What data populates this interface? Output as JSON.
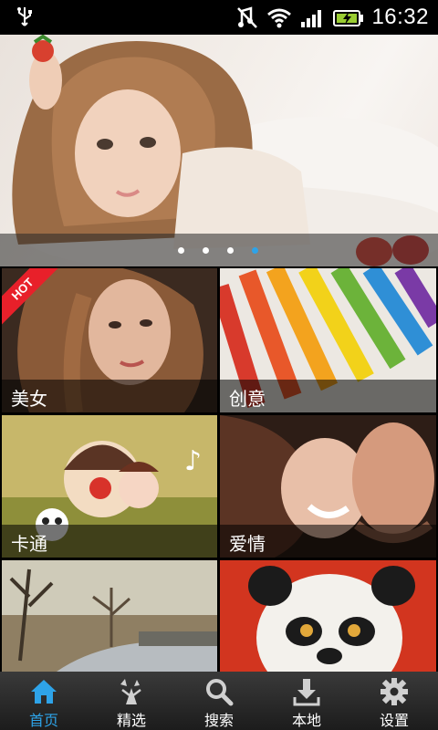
{
  "status_bar": {
    "time": "16:32",
    "icons": [
      "usb-icon",
      "silent-icon",
      "wifi-icon",
      "signal-icon",
      "battery-charging-icon"
    ]
  },
  "banner": {
    "page_count": 4,
    "active_page": 4,
    "description_icon": "banner-photo"
  },
  "categories": [
    {
      "label": "美女",
      "badge": "HOT"
    },
    {
      "label": "创意"
    },
    {
      "label": "卡通"
    },
    {
      "label": "爱情"
    },
    {
      "label": ""
    },
    {
      "label": ""
    }
  ],
  "nav": {
    "items": [
      {
        "label": "首页",
        "icon": "home-icon",
        "active": true
      },
      {
        "label": "精选",
        "icon": "featured-icon"
      },
      {
        "label": "搜索",
        "icon": "search-icon"
      },
      {
        "label": "本地",
        "icon": "download-icon"
      },
      {
        "label": "设置",
        "icon": "gear-icon"
      }
    ]
  },
  "colors": {
    "accent": "#2ea3e8",
    "hot_badge": "#e8202a"
  }
}
